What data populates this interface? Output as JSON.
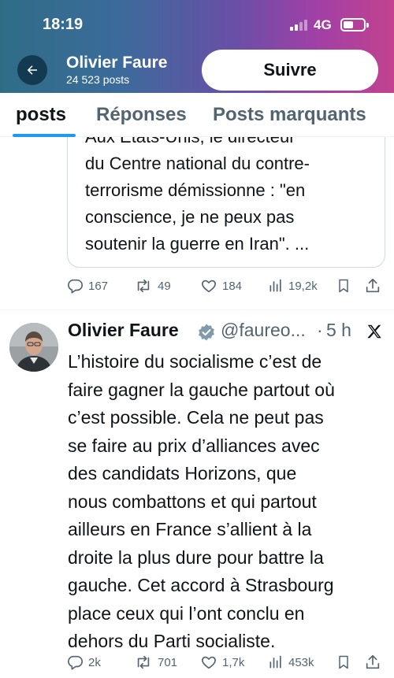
{
  "status_bar": {
    "time": "18:19",
    "network": "4G"
  },
  "profile": {
    "name": "Olivier Faure",
    "posts_count": "24 523 posts",
    "follow_label": "Suivre"
  },
  "tabs": [
    {
      "label": "posts",
      "active": true
    },
    {
      "label": "Réponses",
      "active": false
    },
    {
      "label": "Posts marquants",
      "active": false
    }
  ],
  "quoted_post": {
    "lines": [
      "Aux Etats-Unis, le directeur",
      "du Centre national du contre-",
      "terrorisme démissionne : \"en",
      "conscience, je ne peux pas",
      "soutenir la guerre en Iran\". ..."
    ]
  },
  "first_post_actions": {
    "replies": "167",
    "reposts": "49",
    "likes": "184",
    "views": "19,2k"
  },
  "tweet": {
    "name": "Olivier Faure",
    "handle": "@faureo...",
    "separator": "·",
    "time": "5 h",
    "lines": [
      "L’histoire du socialisme c’est de",
      "faire gagner la gauche partout où",
      "c’est possible. Cela ne peut pas",
      "se faire au prix d’alliances avec",
      "des candidats Horizons, que",
      "nous combattons et qui partout",
      "ailleurs en France s’allient à la",
      "droite la plus dure pour battre la",
      "gauche. Cet accord à Strasbourg",
      "place ceux qui l’ont conclu en",
      "dehors du Parti socialiste."
    ],
    "actions": {
      "replies": "2k",
      "reposts": "701",
      "likes": "1,7k",
      "views": "453k"
    }
  },
  "colors": {
    "accent": "#1d9bf0",
    "verified": "#829aab",
    "muted": "#536471"
  },
  "icons": [
    "back-arrow-icon",
    "reply-icon",
    "repost-icon",
    "like-icon",
    "views-icon",
    "bookmark-icon",
    "share-icon",
    "verified-badge-icon",
    "x-logo-icon"
  ]
}
